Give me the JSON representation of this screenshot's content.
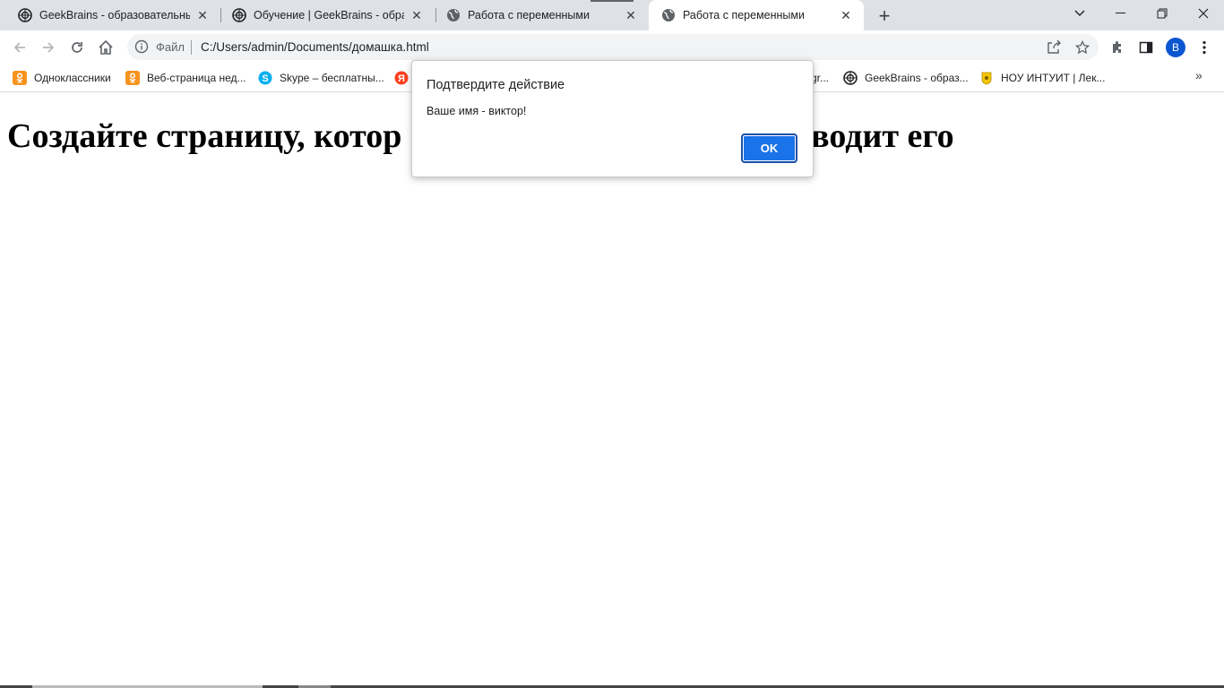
{
  "tabs": [
    {
      "title": "GeekBrains - образовательный п",
      "icon": "geekbrains-icon"
    },
    {
      "title": "Обучение | GeekBrains - образо",
      "icon": "geekbrains-icon"
    },
    {
      "title": "Работа с переменными",
      "icon": "globe-icon"
    },
    {
      "title": "Работа с переменными",
      "icon": "globe-icon",
      "active": true
    }
  ],
  "toolbar": {
    "scheme_label": "Файл",
    "url": "C:/Users/admin/Documents/домашка.html",
    "profile_initial": "B"
  },
  "bookmarks": [
    {
      "label": "Одноклассники",
      "icon": "odnoklassniki-icon",
      "color": "#f7931e"
    },
    {
      "label": "Веб-страница нед...",
      "icon": "odnoklassniki-icon",
      "color": "#f7931e"
    },
    {
      "label": "Skype – бесплатны...",
      "icon": "skype-icon",
      "color": "#00aff0"
    },
    {
      "label": "",
      "icon": "yandex-icon",
      "color": "#fc3f1d"
    },
    {
      "label": "gr...",
      "icon": "",
      "color": ""
    },
    {
      "label": "GeekBrains - образ...",
      "icon": "geekbrains-icon",
      "color": "#000000"
    },
    {
      "label": "НОУ ИНТУИТ | Лек...",
      "icon": "intuit-icon",
      "color": "#f5c400"
    }
  ],
  "page": {
    "heading_left": "Создайте страницу, котор",
    "heading_right": "ыводит его"
  },
  "dialog": {
    "title": "Подтвердите действие",
    "message": "Ваше имя - виктор!",
    "ok_label": "OK"
  },
  "colors": {
    "accent": "#1a73e8",
    "tabstrip": "#dee1e6"
  }
}
